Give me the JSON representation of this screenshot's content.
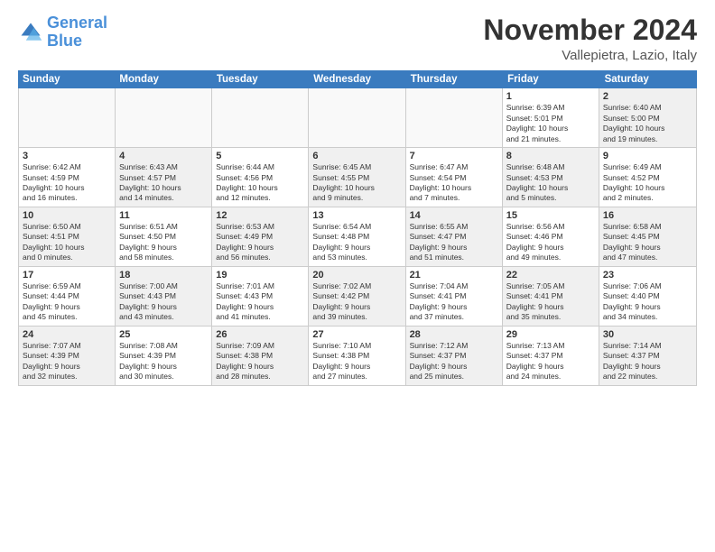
{
  "logo": {
    "line1": "General",
    "line2": "Blue"
  },
  "title": "November 2024",
  "subtitle": "Vallepietra, Lazio, Italy",
  "days_of_week": [
    "Sunday",
    "Monday",
    "Tuesday",
    "Wednesday",
    "Thursday",
    "Friday",
    "Saturday"
  ],
  "weeks": [
    [
      {
        "day": "",
        "info": "",
        "empty": true
      },
      {
        "day": "",
        "info": "",
        "empty": true
      },
      {
        "day": "",
        "info": "",
        "empty": true
      },
      {
        "day": "",
        "info": "",
        "empty": true
      },
      {
        "day": "",
        "info": "",
        "empty": true
      },
      {
        "day": "1",
        "info": "Sunrise: 6:39 AM\nSunset: 5:01 PM\nDaylight: 10 hours\nand 21 minutes."
      },
      {
        "day": "2",
        "info": "Sunrise: 6:40 AM\nSunset: 5:00 PM\nDaylight: 10 hours\nand 19 minutes.",
        "shaded": true
      }
    ],
    [
      {
        "day": "3",
        "info": "Sunrise: 6:42 AM\nSunset: 4:59 PM\nDaylight: 10 hours\nand 16 minutes."
      },
      {
        "day": "4",
        "info": "Sunrise: 6:43 AM\nSunset: 4:57 PM\nDaylight: 10 hours\nand 14 minutes.",
        "shaded": true
      },
      {
        "day": "5",
        "info": "Sunrise: 6:44 AM\nSunset: 4:56 PM\nDaylight: 10 hours\nand 12 minutes."
      },
      {
        "day": "6",
        "info": "Sunrise: 6:45 AM\nSunset: 4:55 PM\nDaylight: 10 hours\nand 9 minutes.",
        "shaded": true
      },
      {
        "day": "7",
        "info": "Sunrise: 6:47 AM\nSunset: 4:54 PM\nDaylight: 10 hours\nand 7 minutes."
      },
      {
        "day": "8",
        "info": "Sunrise: 6:48 AM\nSunset: 4:53 PM\nDaylight: 10 hours\nand 5 minutes.",
        "shaded": true
      },
      {
        "day": "9",
        "info": "Sunrise: 6:49 AM\nSunset: 4:52 PM\nDaylight: 10 hours\nand 2 minutes."
      }
    ],
    [
      {
        "day": "10",
        "info": "Sunrise: 6:50 AM\nSunset: 4:51 PM\nDaylight: 10 hours\nand 0 minutes.",
        "shaded": true
      },
      {
        "day": "11",
        "info": "Sunrise: 6:51 AM\nSunset: 4:50 PM\nDaylight: 9 hours\nand 58 minutes."
      },
      {
        "day": "12",
        "info": "Sunrise: 6:53 AM\nSunset: 4:49 PM\nDaylight: 9 hours\nand 56 minutes.",
        "shaded": true
      },
      {
        "day": "13",
        "info": "Sunrise: 6:54 AM\nSunset: 4:48 PM\nDaylight: 9 hours\nand 53 minutes."
      },
      {
        "day": "14",
        "info": "Sunrise: 6:55 AM\nSunset: 4:47 PM\nDaylight: 9 hours\nand 51 minutes.",
        "shaded": true
      },
      {
        "day": "15",
        "info": "Sunrise: 6:56 AM\nSunset: 4:46 PM\nDaylight: 9 hours\nand 49 minutes."
      },
      {
        "day": "16",
        "info": "Sunrise: 6:58 AM\nSunset: 4:45 PM\nDaylight: 9 hours\nand 47 minutes.",
        "shaded": true
      }
    ],
    [
      {
        "day": "17",
        "info": "Sunrise: 6:59 AM\nSunset: 4:44 PM\nDaylight: 9 hours\nand 45 minutes."
      },
      {
        "day": "18",
        "info": "Sunrise: 7:00 AM\nSunset: 4:43 PM\nDaylight: 9 hours\nand 43 minutes.",
        "shaded": true
      },
      {
        "day": "19",
        "info": "Sunrise: 7:01 AM\nSunset: 4:43 PM\nDaylight: 9 hours\nand 41 minutes."
      },
      {
        "day": "20",
        "info": "Sunrise: 7:02 AM\nSunset: 4:42 PM\nDaylight: 9 hours\nand 39 minutes.",
        "shaded": true
      },
      {
        "day": "21",
        "info": "Sunrise: 7:04 AM\nSunset: 4:41 PM\nDaylight: 9 hours\nand 37 minutes."
      },
      {
        "day": "22",
        "info": "Sunrise: 7:05 AM\nSunset: 4:41 PM\nDaylight: 9 hours\nand 35 minutes.",
        "shaded": true
      },
      {
        "day": "23",
        "info": "Sunrise: 7:06 AM\nSunset: 4:40 PM\nDaylight: 9 hours\nand 34 minutes."
      }
    ],
    [
      {
        "day": "24",
        "info": "Sunrise: 7:07 AM\nSunset: 4:39 PM\nDaylight: 9 hours\nand 32 minutes.",
        "shaded": true
      },
      {
        "day": "25",
        "info": "Sunrise: 7:08 AM\nSunset: 4:39 PM\nDaylight: 9 hours\nand 30 minutes."
      },
      {
        "day": "26",
        "info": "Sunrise: 7:09 AM\nSunset: 4:38 PM\nDaylight: 9 hours\nand 28 minutes.",
        "shaded": true
      },
      {
        "day": "27",
        "info": "Sunrise: 7:10 AM\nSunset: 4:38 PM\nDaylight: 9 hours\nand 27 minutes."
      },
      {
        "day": "28",
        "info": "Sunrise: 7:12 AM\nSunset: 4:37 PM\nDaylight: 9 hours\nand 25 minutes.",
        "shaded": true
      },
      {
        "day": "29",
        "info": "Sunrise: 7:13 AM\nSunset: 4:37 PM\nDaylight: 9 hours\nand 24 minutes."
      },
      {
        "day": "30",
        "info": "Sunrise: 7:14 AM\nSunset: 4:37 PM\nDaylight: 9 hours\nand 22 minutes.",
        "shaded": true
      }
    ]
  ]
}
